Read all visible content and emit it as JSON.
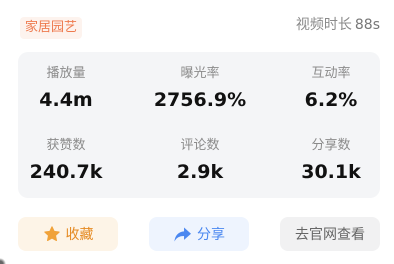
{
  "header": {
    "category": "家居园艺",
    "duration_label": "视频时长",
    "duration_value": "88s"
  },
  "stats": [
    {
      "label": "播放量",
      "value": "4.4m"
    },
    {
      "label": "曝光率",
      "value": "2756.9%"
    },
    {
      "label": "互动率",
      "value": "6.2%"
    },
    {
      "label": "获赞数",
      "value": "240.7k"
    },
    {
      "label": "评论数",
      "value": "2.9k"
    },
    {
      "label": "分享数",
      "value": "30.1k"
    }
  ],
  "actions": {
    "collect": {
      "label": "收藏",
      "icon": "star-icon",
      "color": "#f0a23a"
    },
    "share": {
      "label": "分享",
      "icon": "share-arrow-icon",
      "color": "#4a87f0"
    },
    "site": {
      "label": "去官网查看"
    }
  }
}
